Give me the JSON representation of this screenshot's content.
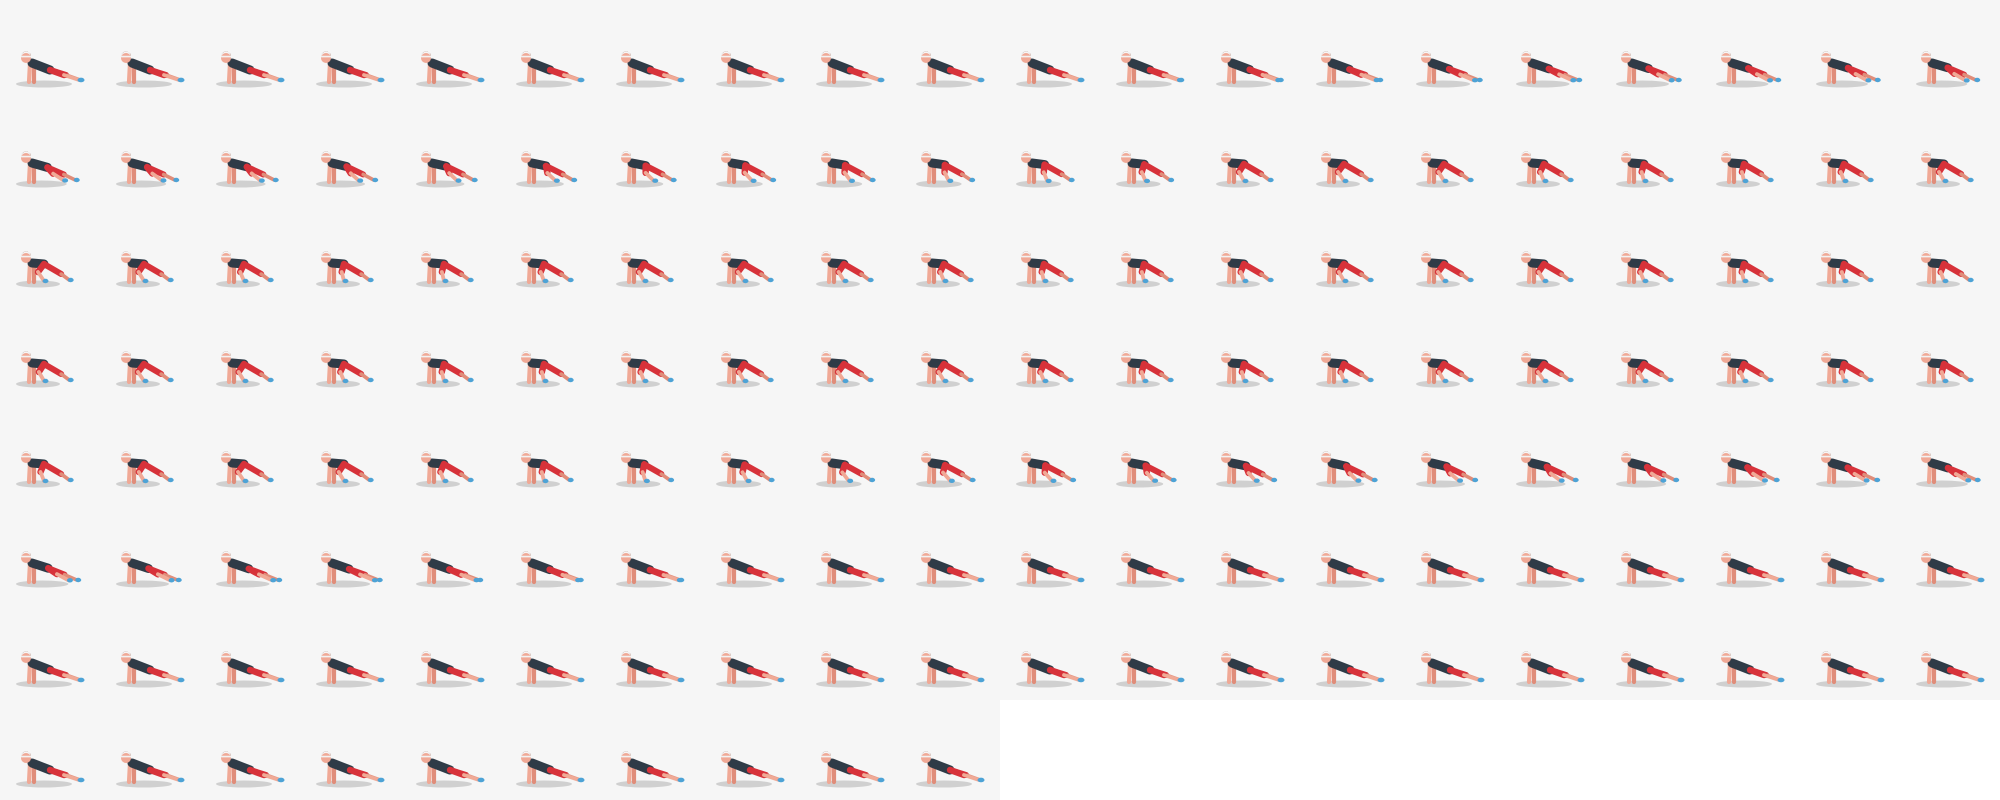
{
  "sprite_sheet": {
    "columns": 20,
    "frame_count": 150,
    "background_color": "#f6f6f6",
    "empty_color": "#ffffff",
    "figure_colors": {
      "skin": "#f0a996",
      "skin_shade": "#e08d7a",
      "shirt": "#2f3b47",
      "shorts": "#d7323a",
      "shoe": "#4da3d6",
      "hair": "#7a3e2b",
      "headband": "#f2f2f2",
      "shadow": "#c9c9c9"
    },
    "pose_keyframes": [
      "plank",
      "plank",
      "knee-drive",
      "tuck",
      "tuck",
      "tuck",
      "tuck",
      "tuck",
      "tuck",
      "knee-drive",
      "plank",
      "plank",
      "plank",
      "plank",
      "plank"
    ],
    "motion": "mountain-climber"
  }
}
